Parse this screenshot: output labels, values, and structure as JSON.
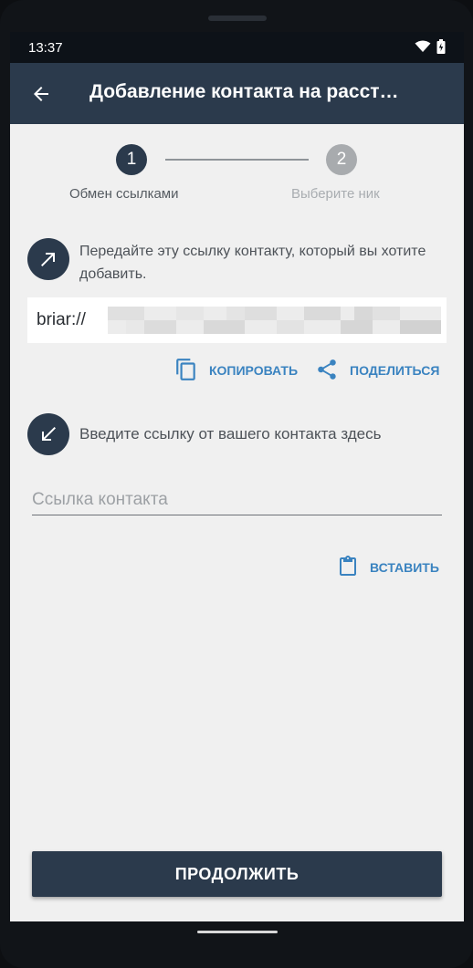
{
  "status_bar": {
    "time": "13:37",
    "icons": [
      "wifi-icon",
      "battery-icon"
    ]
  },
  "app_bar": {
    "back_icon": "arrow-back-icon",
    "title": "Добавление контакта на расст…"
  },
  "stepper": {
    "steps": [
      {
        "number": "1",
        "label": "Обмен ссылками",
        "active": true
      },
      {
        "number": "2",
        "label": "Выберите ник",
        "active": false
      }
    ]
  },
  "share_section": {
    "icon": "arrow-up-right-icon",
    "text": "Передайте эту ссылку контакту, который вы хотите добавить.",
    "link_prefix": "briar://",
    "copy_label": "КОПИРОВАТЬ",
    "share_label": "ПОДЕЛИТЬСЯ"
  },
  "receive_section": {
    "icon": "arrow-down-left-icon",
    "text": "Введите ссылку от вашего контакта здесь",
    "input_placeholder": "Ссылка контакта",
    "input_value": "",
    "paste_label": "ВСТАВИТЬ"
  },
  "footer": {
    "continue_label": "ПРОДОЛЖИТЬ"
  },
  "colors": {
    "primary": "#2b3a4c",
    "accent": "#3a83c0",
    "background": "#f0f0f0",
    "inactive_step": "#a8abae"
  }
}
